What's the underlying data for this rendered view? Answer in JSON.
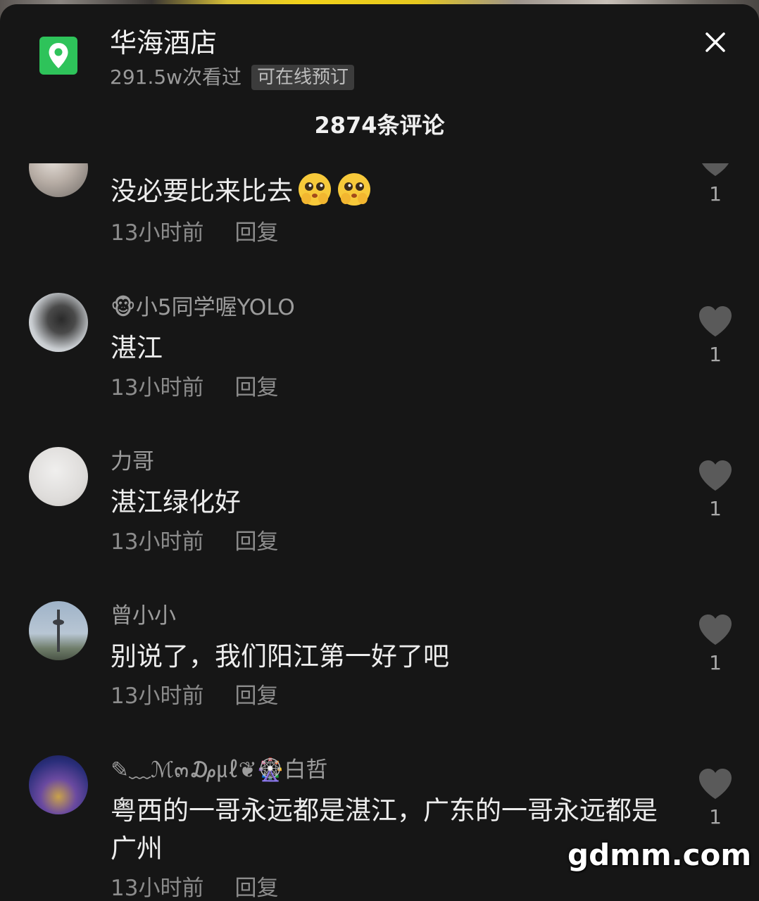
{
  "header": {
    "hotel_name": "华海酒店",
    "views": "291.5w次看过",
    "booking_badge": "可在线预订",
    "comment_count": "2874条评论"
  },
  "comments": [
    {
      "username": "",
      "text": "没必要比来比去",
      "emojis": [
        "pleading-face-emoji",
        "pleading-face-emoji"
      ],
      "time": "13小时前",
      "reply": "回复",
      "likes": "1"
    },
    {
      "username": "🐵小5同学喔YOLO",
      "text": "湛江",
      "time": "13小时前",
      "reply": "回复",
      "likes": "1"
    },
    {
      "username": "力哥",
      "text": "湛江绿化好",
      "time": "13小时前",
      "reply": "回复",
      "likes": "1"
    },
    {
      "username": "曾小小",
      "text": "别说了，我们阳江第一好了吧",
      "time": "13小时前",
      "reply": "回复",
      "likes": "1"
    },
    {
      "username": "✎﹏ℳ๓₯㎕❦🎡白哲",
      "text": "粤西的一哥永远都是湛江，广东的一哥永远都是广州",
      "time": "13小时前",
      "reply": "回复",
      "likes": "1"
    }
  ],
  "watermark": "gdmm.com",
  "colors": {
    "background": "#161616",
    "accent_green": "#2ec35a",
    "text_primary": "#ededed",
    "text_secondary": "#9c9c9c"
  }
}
